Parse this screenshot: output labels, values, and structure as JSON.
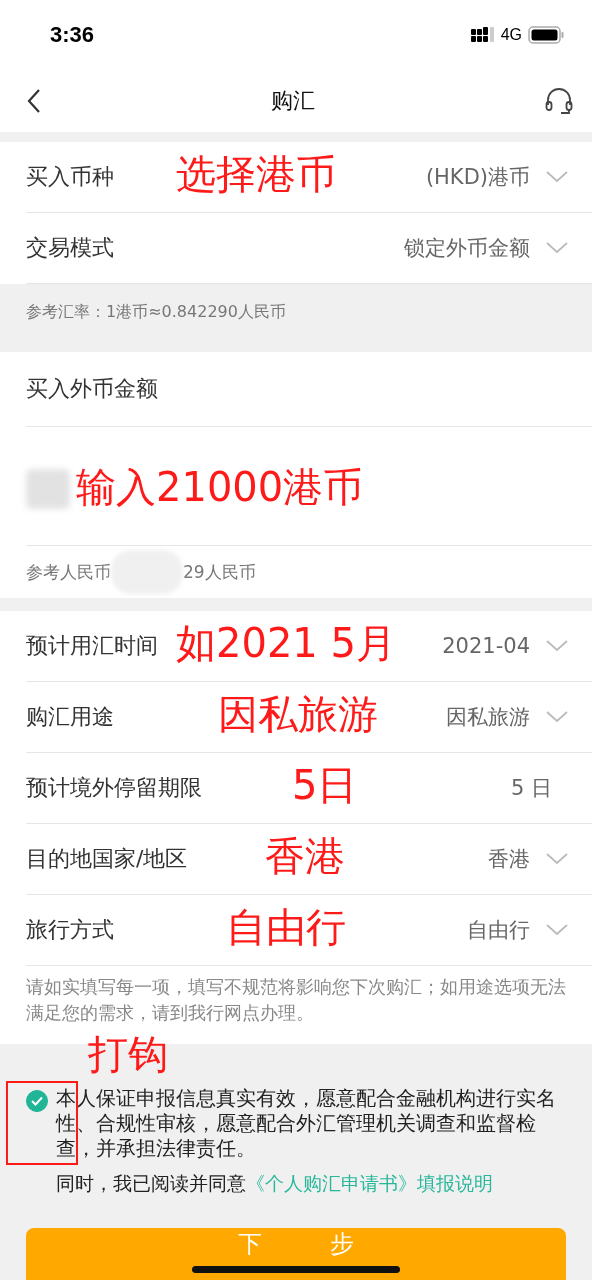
{
  "status_bar": {
    "time": "3:36",
    "network": "4G"
  },
  "nav": {
    "title": "购汇"
  },
  "section_1": [
    {
      "label": "买入币种",
      "value": "(HKD)港币",
      "dropdown": true,
      "annotation": "选择港币"
    },
    {
      "label": "交易模式",
      "value": "锁定外币金额",
      "dropdown": true
    }
  ],
  "rate_note": "参考汇率：1港币≈0.842290人民币",
  "amount": {
    "label": "买入外币金额",
    "annotation": "输入21000港币",
    "reference_before": "参考人民币",
    "reference_after": "29人民币"
  },
  "section_2": [
    {
      "label": "预计用汇时间",
      "value": "2021-04",
      "dropdown": true,
      "annotation": "如2021 5月"
    },
    {
      "label": "购汇用途",
      "value": "因私旅游",
      "dropdown": true,
      "annotation": "因私旅游"
    },
    {
      "label": "预计境外停留期限",
      "value": "5 日",
      "dropdown": false,
      "annotation": "5日"
    },
    {
      "label": "目的地国家/地区",
      "value": "香港",
      "dropdown": true,
      "annotation": "香港"
    },
    {
      "label": "旅行方式",
      "value": "自由行",
      "dropdown": true,
      "annotation": "自由行"
    }
  ],
  "fill_note": "请如实填写每一项，填写不规范将影响您下次购汇；如用途选项无法满足您的需求，请到我行网点办理。",
  "agreement": {
    "checked": true,
    "annotation": "打钩",
    "text": "本人保证申报信息真实有效，愿意配合金融机构进行实名性、合规性审核，愿意配合外汇管理机关调查和监督检查，并承担法律责任。",
    "read_prefix": "同时，我已阅读并同意",
    "link": "《个人购汇申请书》填报说明"
  },
  "next_button": {
    "label": "下 步"
  }
}
